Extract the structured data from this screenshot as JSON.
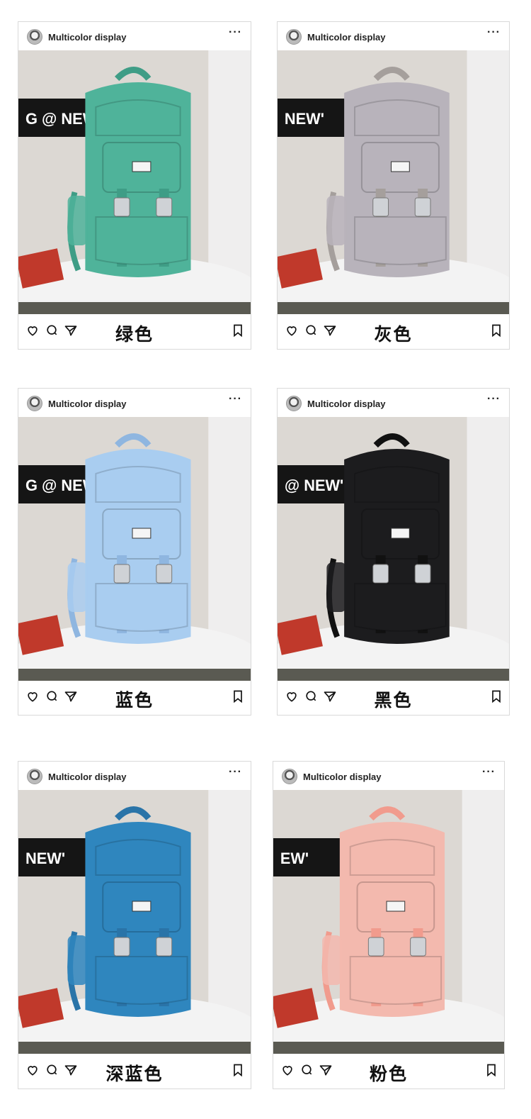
{
  "cards": [
    {
      "username": "Multicolor display",
      "caption": "绿色",
      "wall_text": "G @ NEW'",
      "color": "#4fb39a",
      "strap": "#3f9d86"
    },
    {
      "username": "Multicolor display",
      "caption": "灰色",
      "wall_text": "NEW'",
      "color": "#b8b3bb",
      "strap": "#a59f9c"
    },
    {
      "username": "Multicolor display",
      "caption": "蓝色",
      "wall_text": "G @ NEW",
      "color": "#a9cdf0",
      "strap": "#8fb6e0"
    },
    {
      "username": "Multicolor display",
      "caption": "黑色",
      "wall_text": "@ NEW'",
      "color": "#1c1c1e",
      "strap": "#111111"
    },
    {
      "username": "Multicolor display",
      "caption": "深蓝色",
      "wall_text": "NEW'",
      "color": "#2f86be",
      "strap": "#2a74a8"
    },
    {
      "username": "Multicolor display",
      "caption": "粉色",
      "wall_text": "EW'",
      "color": "#f3b9ae",
      "strap": "#f19b8d"
    }
  ],
  "icons": {
    "more": "more-dots-icon",
    "like": "heart-icon",
    "comment": "comment-icon",
    "share": "send-icon",
    "save": "bookmark-icon"
  },
  "more_symbol": "···"
}
